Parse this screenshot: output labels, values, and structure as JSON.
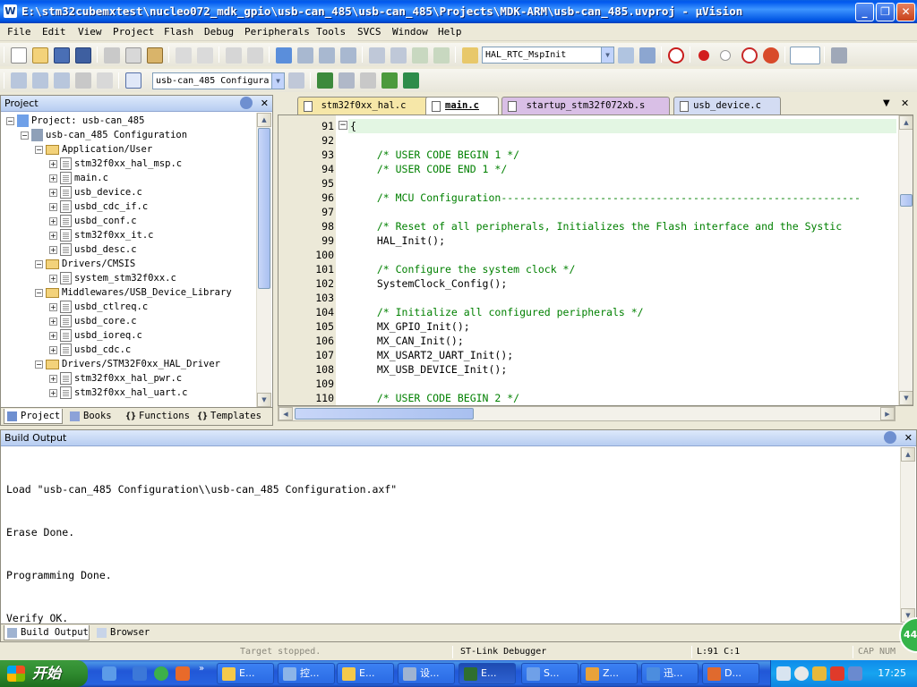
{
  "window": {
    "title": "E:\\stm32cubemxtest\\nucleo072_mdk_gpio\\usb-can_485\\usb-can_485\\Projects\\MDK-ARM\\usb-can_485.uvproj - µVision",
    "app_icon": "keil-uvision-icon"
  },
  "menu": [
    "File",
    "Edit",
    "View",
    "Project",
    "Flash",
    "Debug",
    "Peripherals",
    "Tools",
    "SVCS",
    "Window",
    "Help"
  ],
  "toolbar": {
    "function_combo": "HAL_RTC_MspInit",
    "target_combo": "usb-can_485 Configura"
  },
  "project_panel": {
    "title": "Project",
    "tree": {
      "root": "Project: usb-can_485",
      "target": "usb-can_485 Configuration",
      "groups": [
        {
          "name": "Application/User",
          "files": [
            "stm32f0xx_hal_msp.c",
            "main.c",
            "usb_device.c",
            "usbd_cdc_if.c",
            "usbd_conf.c",
            "stm32f0xx_it.c",
            "usbd_desc.c"
          ]
        },
        {
          "name": "Drivers/CMSIS",
          "files": [
            "system_stm32f0xx.c"
          ]
        },
        {
          "name": "Middlewares/USB_Device_Library",
          "files": [
            "usbd_ctlreq.c",
            "usbd_core.c",
            "usbd_ioreq.c",
            "usbd_cdc.c"
          ]
        },
        {
          "name": "Drivers/STM32F0xx_HAL_Driver",
          "files": [
            "stm32f0xx_hal_pwr.c",
            "stm32f0xx_hal_uart.c"
          ]
        }
      ]
    },
    "tabs": [
      "Project",
      "Books",
      "Functions",
      "Templates"
    ]
  },
  "editor": {
    "tabs": [
      {
        "label": "stm32f0xx_hal.c",
        "color": "#F6E7A8"
      },
      {
        "label": "main.c",
        "color": "#FFFFFF"
      },
      {
        "label": "startup_stm32f072xb.s",
        "color": "#D9BFE6"
      },
      {
        "label": "usb_device.c",
        "color": "#D3DCF3"
      }
    ],
    "lines": [
      {
        "n": "91",
        "text": "{",
        "type": "plain"
      },
      {
        "n": "92",
        "text": "",
        "type": "plain"
      },
      {
        "n": "93",
        "text": "  /* USER CODE BEGIN 1 */",
        "type": "cmt"
      },
      {
        "n": "94",
        "text": "  /* USER CODE END 1 */",
        "type": "cmt"
      },
      {
        "n": "95",
        "text": "",
        "type": "plain"
      },
      {
        "n": "96",
        "text": "  /* MCU Configuration----------------------------------------------------------",
        "type": "cmt"
      },
      {
        "n": "97",
        "text": "",
        "type": "plain"
      },
      {
        "n": "98",
        "text": "  /* Reset of all peripherals, Initializes the Flash interface and the Systic",
        "type": "cmt"
      },
      {
        "n": "99",
        "text": "  HAL_Init();",
        "type": "plain"
      },
      {
        "n": "100",
        "text": "",
        "type": "plain"
      },
      {
        "n": "101",
        "text": "  /* Configure the system clock */",
        "type": "cmt"
      },
      {
        "n": "102",
        "text": "  SystemClock_Config();",
        "type": "plain"
      },
      {
        "n": "103",
        "text": "",
        "type": "plain"
      },
      {
        "n": "104",
        "text": "  /* Initialize all configured peripherals */",
        "type": "cmt"
      },
      {
        "n": "105",
        "text": "  MX_GPIO_Init();",
        "type": "plain"
      },
      {
        "n": "106",
        "text": "  MX_CAN_Init();",
        "type": "plain"
      },
      {
        "n": "107",
        "text": "  MX_USART2_UART_Init();",
        "type": "plain"
      },
      {
        "n": "108",
        "text": "  MX_USB_DEVICE_Init();",
        "type": "plain"
      },
      {
        "n": "109",
        "text": "",
        "type": "plain"
      },
      {
        "n": "110",
        "text": "  /* USER CODE BEGIN 2 */",
        "type": "cmt"
      }
    ]
  },
  "build_output": {
    "title": "Build Output",
    "lines": [
      "Load \"usb-can_485 Configuration\\\\usb-can_485 Configuration.axf\"",
      "Erase Done.",
      "Programming Done.",
      "Verify OK."
    ],
    "tabs": [
      "Build Output",
      "Browser"
    ]
  },
  "status": {
    "target_state": "Target stopped.",
    "debugger": "ST-Link Debugger",
    "position": "L:91 C:1",
    "cap": "CAP",
    "num": "NUM"
  },
  "taskbar": {
    "start_label": "开始",
    "tasks": [
      {
        "label": "E...",
        "icon": "folder-icon",
        "color": "#F5C94A"
      },
      {
        "label": "控...",
        "icon": "control-panel-icon",
        "color": "#8CB4E8"
      },
      {
        "label": "E...",
        "icon": "folder-icon",
        "color": "#F5C94A"
      },
      {
        "label": "设...",
        "icon": "device-manager-icon",
        "color": "#9FB3D1"
      },
      {
        "label": "E...",
        "icon": "keil-icon",
        "color": "#2F6F2F"
      },
      {
        "label": "S...",
        "icon": "security-icon",
        "color": "#6FA0E8"
      },
      {
        "label": "Z...",
        "icon": "z-app-icon",
        "color": "#E8A23A"
      },
      {
        "label": "迅...",
        "icon": "thunder-icon",
        "color": "#4C8DDE"
      },
      {
        "label": "D...",
        "icon": "d-app-icon",
        "color": "#E06A2E"
      }
    ],
    "clock": "17:25",
    "badge": "44"
  }
}
